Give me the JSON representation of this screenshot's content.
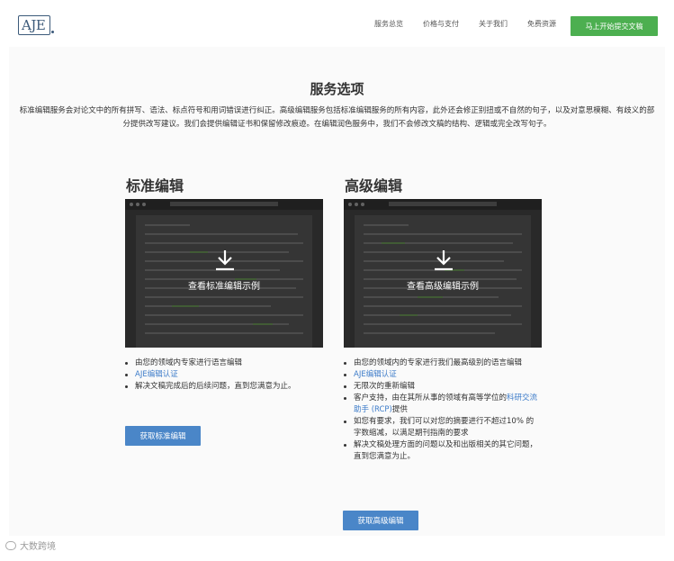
{
  "header": {
    "logo_text": "AJE",
    "nav": [
      "服务总览",
      "价格与支付",
      "关于我们",
      "免费资源"
    ],
    "cta": "马上开始提交文稿"
  },
  "main": {
    "title": "服务选项",
    "description": "标准编辑服务会对论文中的所有拼写、语法、标点符号和用词错误进行纠正。高级编辑服务包括标准编辑服务的所有内容，此外还会修正别扭或不自然的句子，以及对意思模糊、有歧义的部分提供改写建议。我们会提供编辑证书和保留修改痕迹。在编辑润色服务中，我们不会修改文稿的结构、逻辑或完全改写句子。"
  },
  "standard": {
    "title": "标准编辑",
    "preview_label": "查看标准编辑示例",
    "features": [
      {
        "text": "由您的领域内专家进行语言编辑",
        "link": false
      },
      {
        "text": "AJE编辑认证",
        "link": true
      },
      {
        "text": "解决文稿完成后的后续问题，直到您满意为止。",
        "link": false
      }
    ],
    "button": "获取标准编辑"
  },
  "premium": {
    "title": "高级编辑",
    "preview_label": "查看高级编辑示例",
    "features": [
      {
        "text": "由您的领域内的专家进行我们最高级别的语言编辑",
        "link": false
      },
      {
        "text": "AJE编辑认证",
        "link": true
      },
      {
        "text": "无限次的重新编辑",
        "link": false
      },
      {
        "text_before": "客户支持，由在其所从事的领域有高等学位的",
        "link_text": "科研交流助手 (RCP)",
        "text_after": "提供",
        "mixed": true
      },
      {
        "text": "如您有要求，我们可以对您的摘要进行不超过10% 的字数缩减，以满足期刊指南的要求",
        "link": false
      },
      {
        "text": "解决文稿处理方面的问题以及和出版相关的其它问题，直到您满意为止。",
        "link": false
      }
    ],
    "button": "获取高级编辑"
  },
  "watermark": "大数跨境",
  "colors": {
    "cta_green": "#4caf50",
    "button_blue": "#4a86c8",
    "link_blue": "#3d7cc9"
  }
}
